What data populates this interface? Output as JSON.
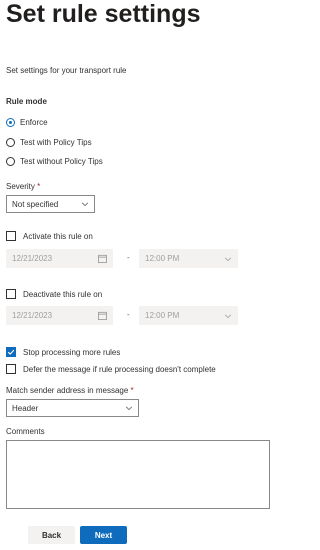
{
  "page": {
    "title": "Set rule settings",
    "description": "Set settings for your transport rule"
  },
  "rule_mode": {
    "label": "Rule mode",
    "options": [
      {
        "label": "Enforce",
        "selected": true
      },
      {
        "label": "Test with Policy Tips",
        "selected": false
      },
      {
        "label": "Test without Policy Tips",
        "selected": false
      }
    ]
  },
  "severity": {
    "label": "Severity",
    "required_mark": "*",
    "value": "Not specified"
  },
  "activate": {
    "label": "Activate this rule on",
    "checked": false,
    "date": "12/21/2023",
    "time": "12:00 PM",
    "separator": "-"
  },
  "deactivate": {
    "label": "Deactivate this rule on",
    "checked": false,
    "date": "12/21/2023",
    "time": "12:00 PM",
    "separator": "-"
  },
  "stop_processing": {
    "label": "Stop processing more rules",
    "checked": true
  },
  "defer": {
    "label": "Defer the message if rule processing doesn't complete",
    "checked": false
  },
  "match_sender": {
    "label": "Match sender address in message",
    "required_mark": "*",
    "value": "Header"
  },
  "comments": {
    "label": "Comments",
    "value": ""
  },
  "footer": {
    "back_label": "Back",
    "next_label": "Next"
  },
  "colors": {
    "accent": "#0f6cbd",
    "disabled_bg": "#f3f2f1"
  }
}
